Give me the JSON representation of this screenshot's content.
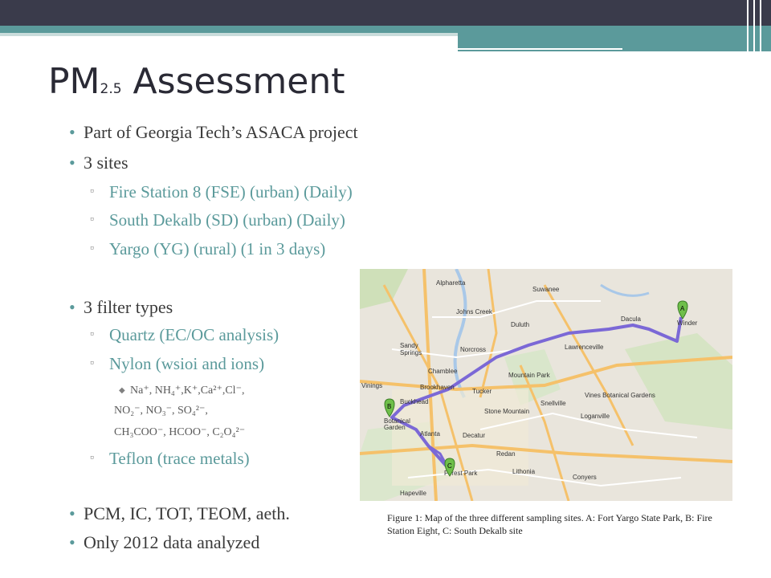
{
  "slide": {
    "title_main": "PM",
    "title_sub": "2.5",
    "title_rest": "Assessment",
    "bullets": {
      "b1": "Part of Georgia Tech’s ASACA project",
      "b2": "3 sites",
      "b2_1": "Fire Station 8 (FSE) (urban) (Daily)",
      "b2_2": "South Dekalb (SD) (urban) (Daily)",
      "b2_3": "Yargo (YG) (rural) (1 in 3 days)",
      "b3": "3 filter types",
      "b3_1": "Quartz (EC/OC analysis)",
      "b3_2": "Nylon (wsioi and ions)",
      "ions1": "Na⁺, NH₄⁺,K⁺,Ca²⁺,Cl⁻,",
      "ions2": "NO₂⁻, NO₃⁻, SO₄²⁻,",
      "ions3": "CH₃COO⁻, HCOO⁻, C₂O₄²⁻",
      "b3_3": "Teflon (trace metals)",
      "b4": "PCM, IC, TOT, TEOM, aeth.",
      "b5": "Only 2012 data analyzed"
    },
    "caption": "Figure 1: Map of the three different sampling sites. A: Fort Yargo State Park, B: Fire Station Eight, C: South Dekalb site"
  },
  "map": {
    "places": [
      "Alpharetta",
      "Suwanee",
      "Johns Creek",
      "Duluth",
      "Dacula",
      "Sandy Springs",
      "Norcross",
      "Lawrenceville",
      "Chamblee",
      "Brookhaven",
      "Tucker",
      "Vinings",
      "Buckhead",
      "Snellville",
      "Loganville",
      "Stone Mountain",
      "Atlanta",
      "Decatur",
      "Forest Park",
      "Hapeville",
      "Lithonia",
      "Redan",
      "Conyers",
      "Winder",
      "Botanical Garden",
      "Vines Botanical Gardens",
      "Mountain Park"
    ],
    "markers": [
      "A",
      "B",
      "C"
    ],
    "route_color": "#7b68d6"
  },
  "colors": {
    "accent": "#5b9a9b",
    "dark_bar": "#3a3b4b"
  }
}
